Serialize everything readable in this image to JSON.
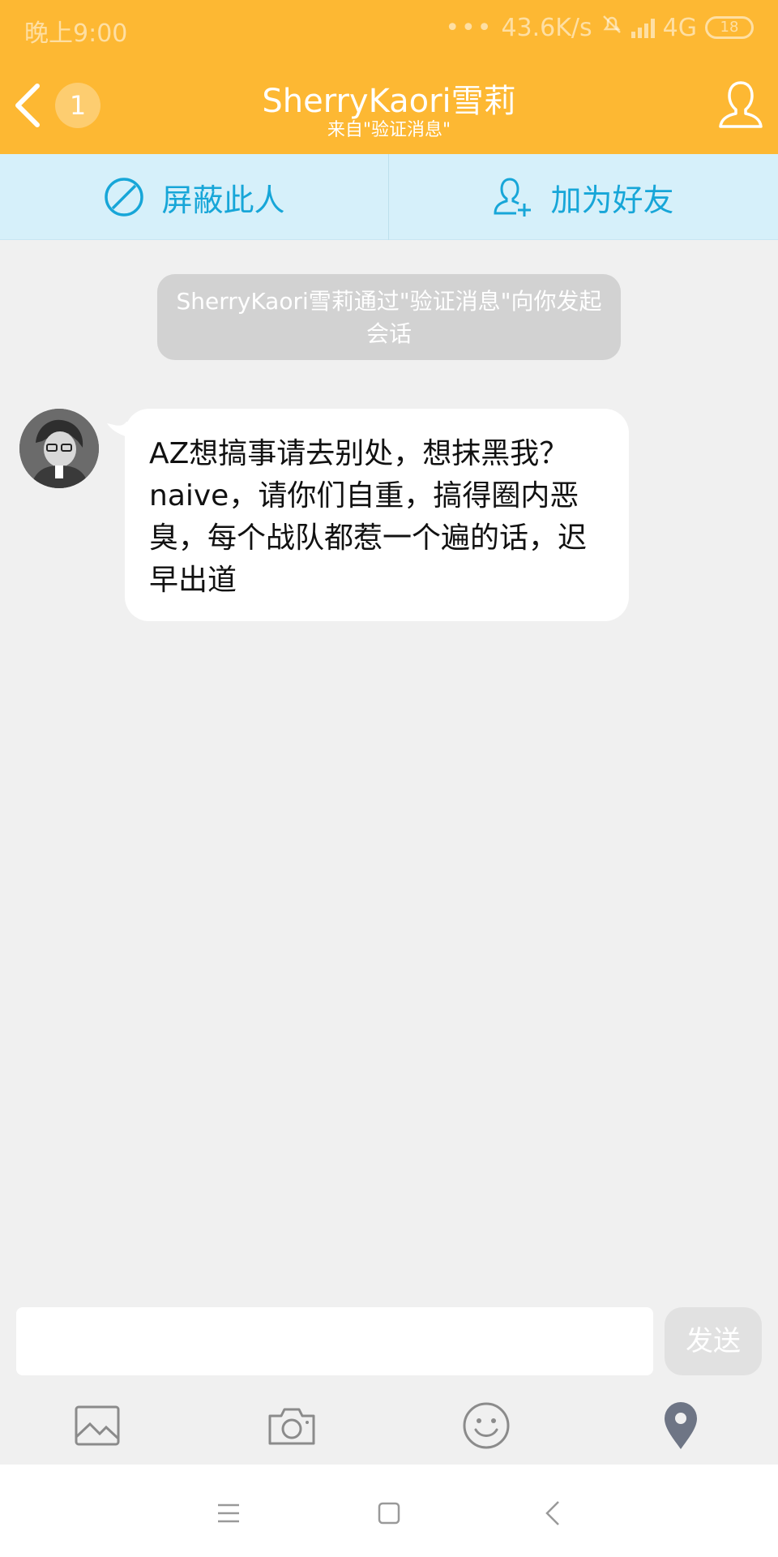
{
  "status_bar": {
    "time": "晚上9:00",
    "network_speed": "43.6K/s",
    "network_type": "4G",
    "battery": "18"
  },
  "header": {
    "unread_count": "1",
    "title": "SherryKaori雪莉",
    "subtitle": "来自\"验证消息\""
  },
  "actions": {
    "block_label": "屏蔽此人",
    "add_friend_label": "加为好友"
  },
  "notice": {
    "text": "SherryKaori雪莉通过\"验证消息\"向你发起会话"
  },
  "messages": [
    {
      "sender": "SherryKaori雪莉",
      "text": "AZ想搞事请去别处，想抹黑我？naive，请你们自重，搞得圈内恶臭，每个战队都惹一个遍的话，迟早出道"
    }
  ],
  "composer": {
    "value": "",
    "placeholder": "",
    "send_label": "发送"
  },
  "toolbar": {
    "items": [
      "image-icon",
      "camera-icon",
      "emoji-icon",
      "location-icon"
    ]
  },
  "colors": {
    "header_bg": "#fdb833",
    "action_bar_bg": "#d6f0fa",
    "action_text": "#17a6d8",
    "chat_bg": "#f0f0f0"
  }
}
